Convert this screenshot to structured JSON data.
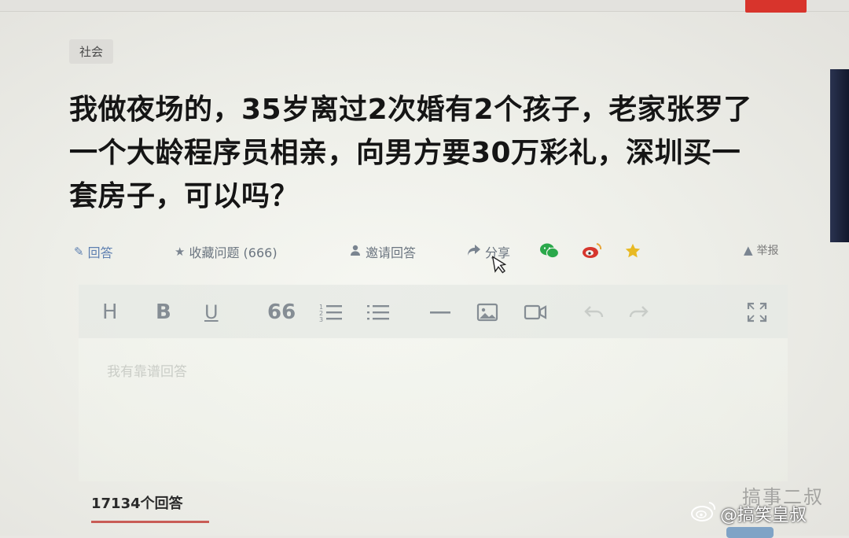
{
  "topic_tag": "社会",
  "question": {
    "title_line1": "我做夜场的，35岁离过2次婚有2个孩子，老家张罗了",
    "title_line2": "一个大龄程序员相亲，向男方要30万彩礼，深圳买一",
    "title_line3": "套房子，可以吗？"
  },
  "actions": {
    "answer": "回答",
    "follow": "收藏问题 (666)",
    "invite": "邀请回答",
    "share": "分享",
    "report": "举报"
  },
  "editor": {
    "toolbar": {
      "heading": "H",
      "bold": "B",
      "underline": "U",
      "quote": "66"
    },
    "placeholder": "我有靠谱回答"
  },
  "answers": {
    "count_label": "17134个回答"
  },
  "watermark": {
    "ghost": "搞事二叔",
    "handle": "@搞笑皇叔"
  },
  "colors": {
    "accent_blue": "#5d7fb0",
    "wechat_green": "#2aa84a",
    "weibo_red": "#d6362d",
    "star_yellow": "#e8b923",
    "tab_underline": "#c95c56"
  }
}
